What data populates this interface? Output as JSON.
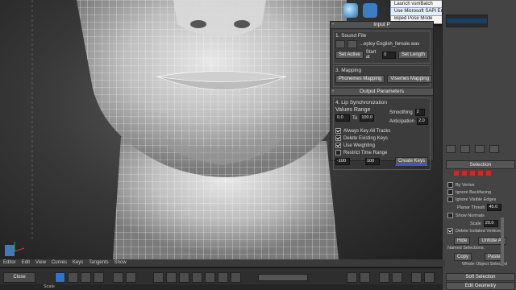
{
  "dropdown_menu": {
    "items": [
      "Launch vsmBatch",
      "Use Microsoft SAPI Engine",
      "Biped Pose Mode"
    ],
    "highlighted_index": 1
  },
  "sound_file": {
    "group_label": "1. Sound File",
    "file_name": "...eploy English_female.wav",
    "set_active": "Set Active",
    "start_at_label": "Start at",
    "start_at_value": "0",
    "set_length": "Set Length"
  },
  "mapping": {
    "group_label": "3. Mapping",
    "phonemes_button": "Phonemes Mapping",
    "visemes_button": "Visemes Mapping"
  },
  "output": {
    "title": "Output Parameters",
    "sync_label": "4. Lip Synchronization",
    "values_range_label": "Values Range",
    "range_from": "0.0",
    "to_label": "To",
    "range_to": "100.0",
    "smoothing_label": "Smoothing",
    "smoothing_value": "2",
    "anticipation_label": "Anticipation",
    "anticipation_value": "2.0",
    "always_key_all_tracks": "Always Key All Tracks",
    "delete_existing_keys": "Delete Existing Keys",
    "use_weighting": "Use Weighting",
    "restrict_time_range": "Restrict Time Range",
    "range_start": "-100",
    "range_end": "100",
    "create_keys": "Create Keys"
  },
  "input_header": "Input P",
  "command_panel": {
    "selection_header": "Selection",
    "options": [
      "By Vertex",
      "Ignore Backfacing",
      "Ignore Visible Edges",
      "Planar Thresh",
      "Show Normals",
      "Scale",
      "Delete Isolated Vertices"
    ],
    "planar_thresh_value": "45.0",
    "scale_value": "20.0",
    "hide_button": "Hide",
    "unhide_all_button": "Unhide All",
    "named_selections_label": "Named Selections:",
    "copy_button": "Copy",
    "paste_button": "Paste",
    "whole_object_selected": "Whole Object Selected",
    "soft_selection": "Soft Selection",
    "edit_geometry": "Edit Geometry"
  },
  "menubar": [
    "Editor",
    "Edit",
    "View",
    "Curves",
    "Keys",
    "Tangents",
    "Show"
  ],
  "toolbar": {
    "close_label": "Close"
  },
  "timeline": {
    "scale_label": "Scale"
  }
}
